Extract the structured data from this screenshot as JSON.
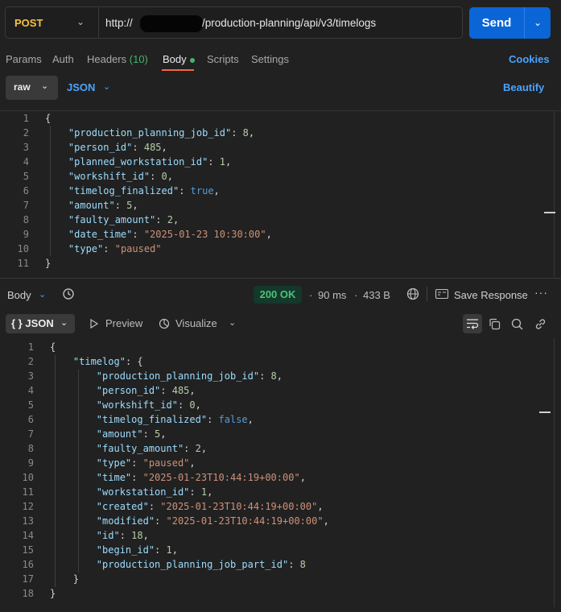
{
  "request": {
    "method": "POST",
    "url_prefix": "http://",
    "url_path": "/production-planning/api/v3/timelogs",
    "send_label": "Send"
  },
  "tabs": {
    "params": "Params",
    "auth": "Auth",
    "headers": "Headers",
    "headers_count": "(10)",
    "body": "Body",
    "scripts": "Scripts",
    "settings": "Settings",
    "cookies": "Cookies"
  },
  "body_options": {
    "mode": "raw",
    "format": "JSON",
    "beautify": "Beautify"
  },
  "request_body_lines": [
    [
      "{"
    ],
    [
      "    ",
      "k:\"production_planning_job_id\"",
      "p:: ",
      "n:8",
      "p:,"
    ],
    [
      "    ",
      "k:\"person_id\"",
      "p:: ",
      "n:485",
      "p:,"
    ],
    [
      "    ",
      "k:\"planned_workstation_id\"",
      "p:: ",
      "n:1",
      "p:,"
    ],
    [
      "    ",
      "k:\"workshift_id\"",
      "p:: ",
      "n:0",
      "p:,"
    ],
    [
      "    ",
      "k:\"timelog_finalized\"",
      "p:: ",
      "b:true",
      "p:,"
    ],
    [
      "    ",
      "k:\"amount\"",
      "p:: ",
      "n:5",
      "p:,"
    ],
    [
      "    ",
      "k:\"faulty_amount\"",
      "p:: ",
      "n:2",
      "p:,"
    ],
    [
      "    ",
      "k:\"date_time\"",
      "p:: ",
      "s:\"2025-01-23 10:30:00\"",
      "p:,"
    ],
    [
      "    ",
      "k:\"type\"",
      "p:: ",
      "s:\"paused\""
    ],
    [
      "}"
    ]
  ],
  "response": {
    "body_label": "Body",
    "status": "200 OK",
    "time": "90 ms",
    "size": "433 B",
    "save_label": "Save Response",
    "more": "···",
    "view_mode": "{ } JSON",
    "preview": "Preview",
    "visualize": "Visualize"
  },
  "response_body_lines": [
    [
      "{"
    ],
    [
      "    ",
      "k:\"timelog\"",
      "p:: {"
    ],
    [
      "        ",
      "k:\"production_planning_job_id\"",
      "p:: ",
      "n:8",
      "p:,"
    ],
    [
      "        ",
      "k:\"person_id\"",
      "p:: ",
      "n:485",
      "p:,"
    ],
    [
      "        ",
      "k:\"workshift_id\"",
      "p:: ",
      "n:0",
      "p:,"
    ],
    [
      "        ",
      "k:\"timelog_finalized\"",
      "p:: ",
      "b:false",
      "p:,"
    ],
    [
      "        ",
      "k:\"amount\"",
      "p:: ",
      "n:5",
      "p:,"
    ],
    [
      "        ",
      "k:\"faulty_amount\"",
      "p:: ",
      "n:2",
      "p:,"
    ],
    [
      "        ",
      "k:\"type\"",
      "p:: ",
      "s:\"paused\"",
      "p:,"
    ],
    [
      "        ",
      "k:\"time\"",
      "p:: ",
      "s:\"2025-01-23T10:44:19+00:00\"",
      "p:,"
    ],
    [
      "        ",
      "k:\"workstation_id\"",
      "p:: ",
      "n:1",
      "p:,"
    ],
    [
      "        ",
      "k:\"created\"",
      "p:: ",
      "s:\"2025-01-23T10:44:19+00:00\"",
      "p:,"
    ],
    [
      "        ",
      "k:\"modified\"",
      "p:: ",
      "s:\"2025-01-23T10:44:19+00:00\"",
      "p:,"
    ],
    [
      "        ",
      "k:\"id\"",
      "p:: ",
      "n:18",
      "p:,"
    ],
    [
      "        ",
      "k:\"begin_id\"",
      "p:: ",
      "n:1",
      "p:,"
    ],
    [
      "        ",
      "k:\"production_planning_job_part_id\"",
      "p:: ",
      "n:8"
    ],
    [
      "    ",
      "p:}"
    ],
    [
      "}"
    ]
  ],
  "colors": {
    "accent": "#0a66d6",
    "link": "#4aa3ff",
    "method": "#f6c244",
    "status_ok": "#4cc37a",
    "active_tab_underline": "#f26b3a"
  }
}
